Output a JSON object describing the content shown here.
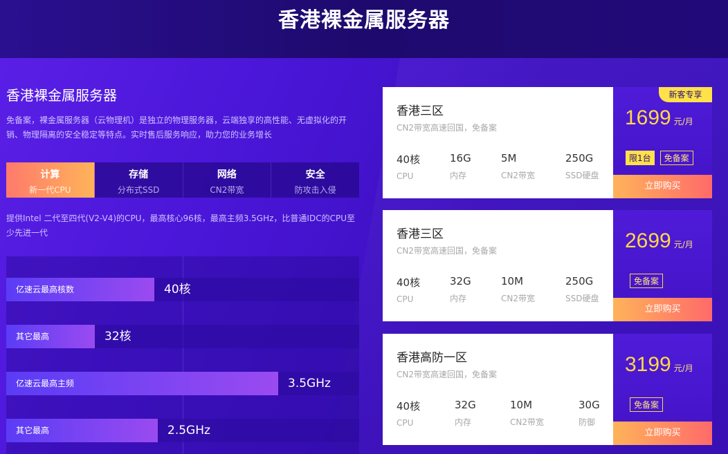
{
  "header": {
    "title": "香港裸金属服务器"
  },
  "intro": {
    "title": "香港裸金属服务器",
    "description": "免备案，裸金属服务器（云物理机）是独立的物理服务器，云端独享的高性能、无虚拟化的开销、物理隔离的安全稳定等特点。实时售后服务响应，助力您的业务增长"
  },
  "tabs": [
    {
      "label": "计算",
      "sub": "新一代CPU",
      "active": true
    },
    {
      "label": "存储",
      "sub": "分布式SSD",
      "active": false
    },
    {
      "label": "网络",
      "sub": "CN2带宽",
      "active": false
    },
    {
      "label": "安全",
      "sub": "防攻击入侵",
      "active": false
    }
  ],
  "cpu_description": "提供Intel 二代至四代(V2-V4)的CPU，最高核心96核，最高主频3.5GHz，比普通IDC的CPU至少先进一代",
  "comparison": [
    {
      "label": "亿速云最高核数",
      "value": "40核",
      "fill": 0.42
    },
    {
      "label": "其它最高",
      "value": "32核",
      "fill": 0.25
    },
    {
      "label": "亿速云最高主频",
      "value": "3.5GHz",
      "fill": 0.77
    },
    {
      "label": "其它最高",
      "value": "2.5GHz",
      "fill": 0.43
    }
  ],
  "products": [
    {
      "name": "香港三区",
      "subtitle": "CN2带宽高速回国，免备案",
      "specs": [
        {
          "value": "40核",
          "label": "CPU"
        },
        {
          "value": "16G",
          "label": "内存"
        },
        {
          "value": "5M",
          "label": "CN2带宽"
        },
        {
          "value": "250G",
          "label": "SSD硬盘"
        }
      ],
      "price": "1699",
      "unit": "元/月",
      "ribbon": "新客专享",
      "tags": [
        {
          "text": "限1台",
          "style": "filled"
        },
        {
          "text": "免备案",
          "style": "outline"
        }
      ],
      "buy": "立即购买"
    },
    {
      "name": "香港三区",
      "subtitle": "CN2带宽高速回国，免备案",
      "specs": [
        {
          "value": "40核",
          "label": "CPU"
        },
        {
          "value": "32G",
          "label": "内存"
        },
        {
          "value": "10M",
          "label": "CN2带宽"
        },
        {
          "value": "250G",
          "label": "SSD硬盘"
        }
      ],
      "price": "2699",
      "unit": "元/月",
      "ribbon": "",
      "tags": [
        {
          "text": "免备案",
          "style": "outline"
        }
      ],
      "buy": "立即购买"
    },
    {
      "name": "香港高防一区",
      "subtitle": "CN2带宽高速回国，免备案",
      "specs": [
        {
          "value": "40核",
          "label": "CPU"
        },
        {
          "value": "32G",
          "label": "内存"
        },
        {
          "value": "10M",
          "label": "CN2带宽"
        },
        {
          "value": "30G",
          "label": "防御"
        }
      ],
      "price": "3199",
      "unit": "元/月",
      "ribbon": "",
      "tags": [
        {
          "text": "免备案",
          "style": "outline"
        }
      ],
      "buy": "立即购买"
    }
  ]
}
